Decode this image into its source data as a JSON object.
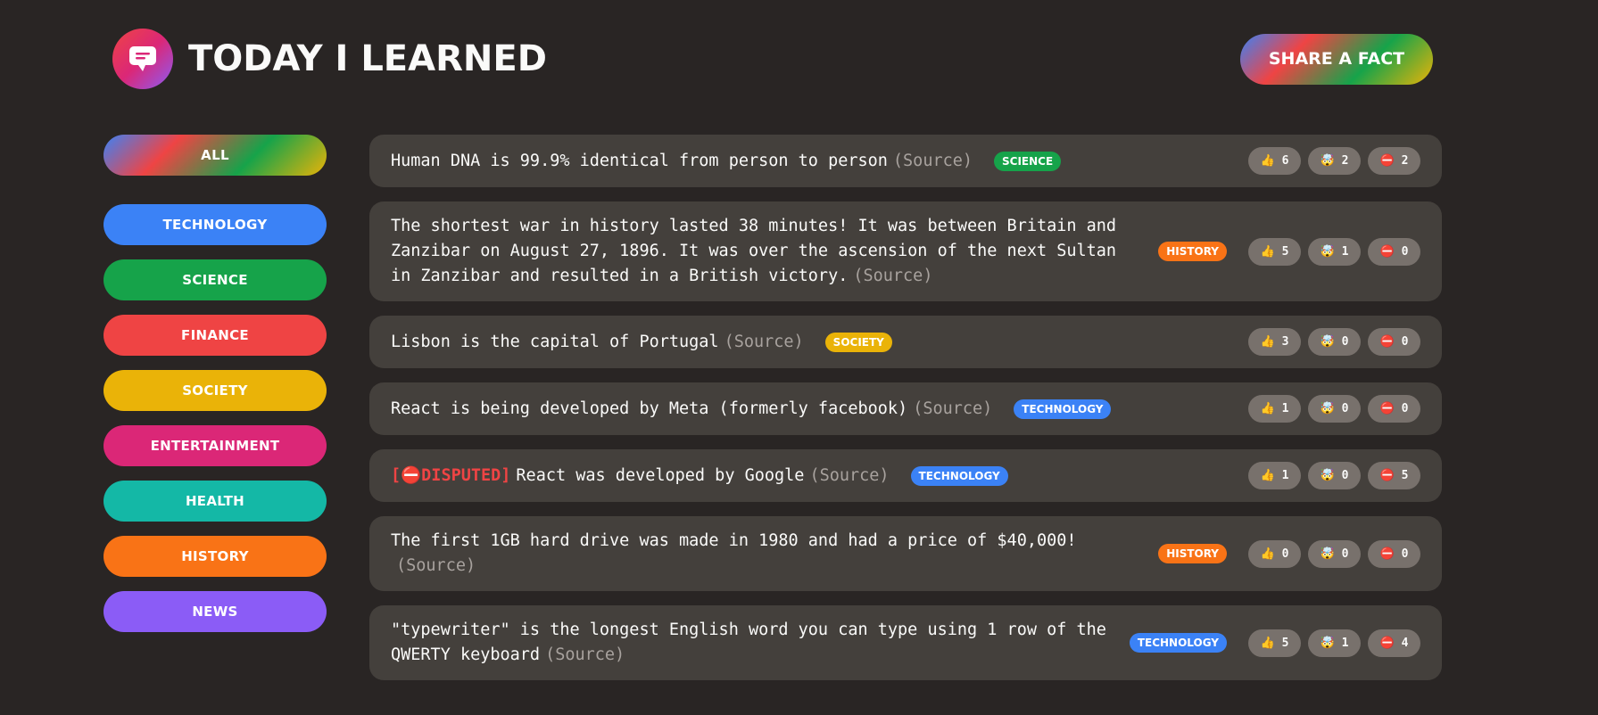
{
  "header": {
    "title": "Today I Learned",
    "share_label": "Share a fact"
  },
  "sidebar": {
    "all_label": "All",
    "categories": [
      {
        "label": "Technology",
        "color": "#3b82f6"
      },
      {
        "label": "Science",
        "color": "#16a34a"
      },
      {
        "label": "Finance",
        "color": "#ef4444"
      },
      {
        "label": "Society",
        "color": "#eab308"
      },
      {
        "label": "Entertainment",
        "color": "#db2777"
      },
      {
        "label": "Health",
        "color": "#14b8a6"
      },
      {
        "label": "History",
        "color": "#f97316"
      },
      {
        "label": "News",
        "color": "#8b5cf6"
      }
    ]
  },
  "facts": [
    {
      "text": "Human DNA is 99.9% identical from person to person",
      "source": "(Source)",
      "category": "Science",
      "category_color": "#16a34a",
      "likes": "6",
      "mindblowing": "2",
      "false": "2"
    },
    {
      "text": "The shortest war in history lasted 38 minutes! It was between Britain and Zanzibar on August 27, 1896. It was over the ascension of the next Sultan in Zanzibar and resulted in a British victory.",
      "source": "(Source)",
      "category": "History",
      "category_color": "#f97316",
      "likes": "5",
      "mindblowing": "1",
      "false": "0"
    },
    {
      "text": "Lisbon is the capital of Portugal",
      "source": "(Source)",
      "category": "Society",
      "category_color": "#eab308",
      "likes": "3",
      "mindblowing": "0",
      "false": "0"
    },
    {
      "text": "React is being developed by Meta (formerly facebook)",
      "source": "(Source)",
      "category": "Technology",
      "category_color": "#3b82f6",
      "likes": "1",
      "mindblowing": "0",
      "false": "0"
    },
    {
      "disputed": "[⛔DISPUTED]",
      "text": "React was developed by Google",
      "source": "(Source)",
      "category": "Technology",
      "category_color": "#3b82f6",
      "likes": "1",
      "mindblowing": "0",
      "false": "5"
    },
    {
      "text": "The first 1GB hard drive was made in 1980 and had a price of $40,000!",
      "source": "(Source)",
      "category": "History",
      "category_color": "#f97316",
      "likes": "0",
      "mindblowing": "0",
      "false": "0"
    },
    {
      "text": "\"typewriter\" is the longest English word you can type using 1 row of the QWERTY keyboard",
      "source": "(Source)",
      "category": "Technology",
      "category_color": "#3b82f6",
      "likes": "5",
      "mindblowing": "1",
      "false": "4"
    }
  ],
  "icons": {
    "like": "👍",
    "mindblowing": "🤯",
    "false": "⛔"
  }
}
